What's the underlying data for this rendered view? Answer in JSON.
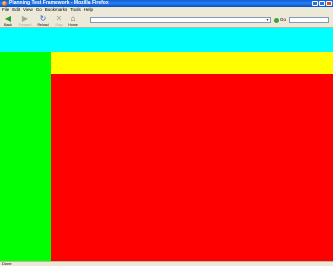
{
  "window": {
    "title": "Planning Test Framework - Mozilla Firefox"
  },
  "menubar": {
    "items": [
      "File",
      "Edit",
      "View",
      "Go",
      "Bookmarks",
      "Tools",
      "Help"
    ]
  },
  "toolbar": {
    "back_label": "Back",
    "forward_label": "Forward",
    "reload_label": "Reload",
    "stop_label": "Stop",
    "home_label": "Home",
    "go_label": "Go",
    "icons": {
      "back": "arrow-left-icon",
      "forward": "arrow-right-icon",
      "reload": "reload-icon",
      "stop": "stop-icon",
      "home": "home-icon",
      "go": "go-icon"
    }
  },
  "address_bar": {
    "value": ""
  },
  "page": {
    "colors": {
      "banner": "#00ffff",
      "left_panel": "#00ff00",
      "bar": "#ffff00",
      "main": "#ff0000"
    }
  },
  "statusbar": {
    "text": "Done"
  }
}
